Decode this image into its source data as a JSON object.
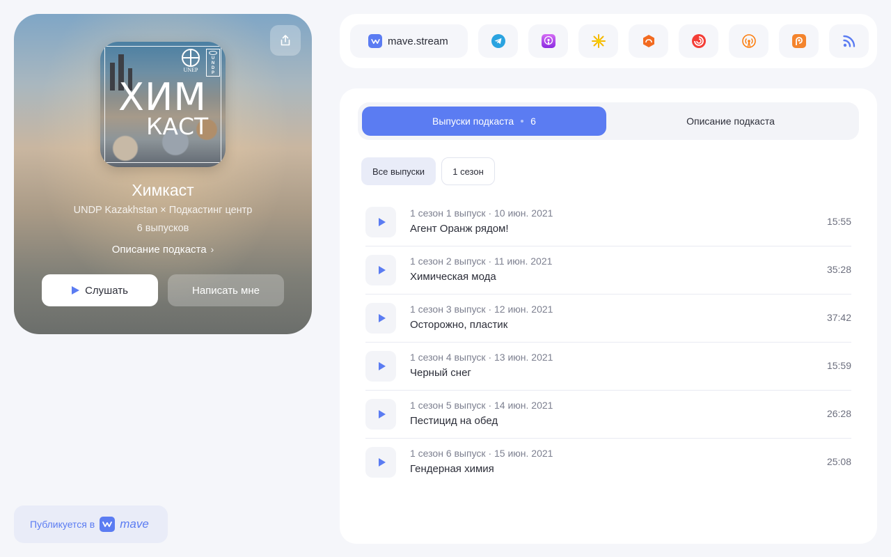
{
  "podcast": {
    "cover_title_line1": "ХИМ",
    "cover_title_line2": "КАСТ",
    "cover_logo_unep": "UNEP",
    "cover_logo_undp": [
      "U",
      "N",
      "D",
      "P"
    ],
    "title": "Химкаст",
    "author": "UNDP Kazakhstan × Подкастинг центр",
    "episode_count_label": "6 выпусков",
    "description_link": "Описание подкаста",
    "listen_button": "Слушать",
    "write_button": "Написать мне"
  },
  "published_badge": {
    "label": "Публикуется в",
    "brand": "mave"
  },
  "platforms": {
    "main_label": "mave.stream",
    "icons": [
      "telegram-icon",
      "apple-podcasts-icon",
      "yandex-music-icon",
      "soundstream-icon",
      "pocket-casts-icon",
      "overcast-icon",
      "podcast-addict-icon",
      "rss-icon"
    ]
  },
  "tabs": {
    "episodes_label": "Выпуски подкаста",
    "episodes_count": "6",
    "description_label": "Описание подкаста"
  },
  "filters": {
    "all": "Все выпуски",
    "season1": "1 сезон"
  },
  "episodes": [
    {
      "meta": "1 сезон 1 выпуск · 10 июн. 2021",
      "title": "Агент Оранж рядом!",
      "duration": "15:55"
    },
    {
      "meta": "1 сезон 2 выпуск · 11 июн. 2021",
      "title": "Химическая мода",
      "duration": "35:28"
    },
    {
      "meta": "1 сезон 3 выпуск · 12 июн. 2021",
      "title": "Осторожно, пластик",
      "duration": "37:42"
    },
    {
      "meta": "1 сезон 4 выпуск · 13 июн. 2021",
      "title": "Черный снег",
      "duration": "15:59"
    },
    {
      "meta": "1 сезон 5 выпуск · 14 июн. 2021",
      "title": "Пестицид на обед",
      "duration": "26:28"
    },
    {
      "meta": "1 сезон 6 выпуск · 15 июн. 2021",
      "title": "Гендерная химия",
      "duration": "25:08"
    }
  ],
  "colors": {
    "accent": "#5b7cf2",
    "background": "#f5f6fa",
    "panel": "#ffffff"
  }
}
